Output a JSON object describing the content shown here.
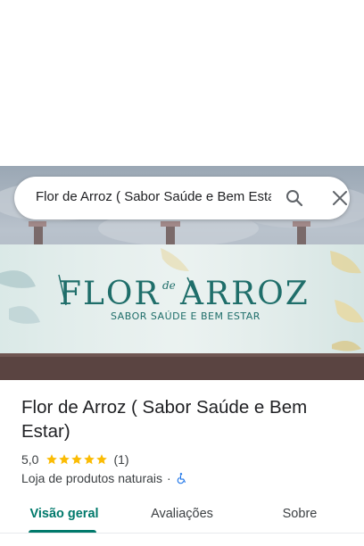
{
  "search": {
    "query": "Flor de Arroz ( Sabor Saúde e Bem Estar)",
    "search_icon": "search-icon",
    "close_icon": "close-icon"
  },
  "photo": {
    "sign_main_left": "FLOR",
    "sign_main_mid": "de",
    "sign_main_right": "ARROZ",
    "sign_sub": "SABOR SAÚDE E BEM ESTAR"
  },
  "place": {
    "name": "Flor de Arroz ( Sabor Saúde e Bem Estar)",
    "rating": "5,0",
    "stars": 5,
    "review_count": "(1)",
    "category": "Loja de produtos naturais",
    "separator": "·",
    "accessibility_icon": "wheelchair-icon"
  },
  "tabs": {
    "items": [
      "Visão geral",
      "Avaliações",
      "Sobre"
    ],
    "active": "Visão geral"
  },
  "colors": {
    "accent": "#00796b",
    "star": "#fbbc04",
    "accessibility": "#1a73e8"
  }
}
